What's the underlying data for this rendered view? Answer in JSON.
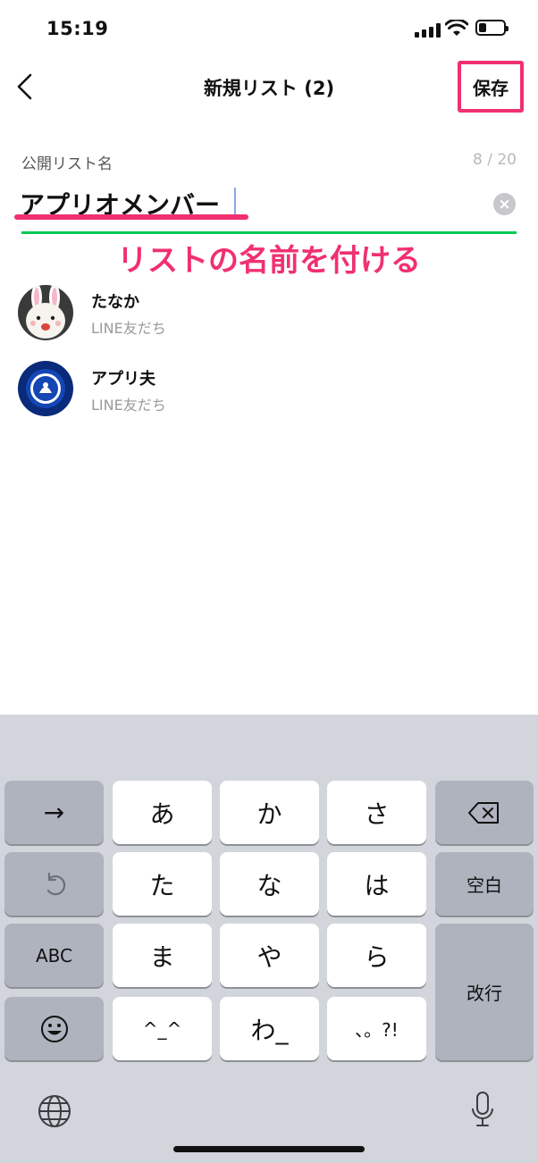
{
  "status": {
    "time": "15:19"
  },
  "nav": {
    "title": "新規リスト (2)",
    "save": "保存"
  },
  "form": {
    "label": "公開リスト名",
    "counter": "8 / 20",
    "value": "アプリオメンバー",
    "clear": "×"
  },
  "annotation": "リストの名前を付ける",
  "members": [
    {
      "name": "たなか",
      "sub": "LINE友だち"
    },
    {
      "name": "アプリ夫",
      "sub": "LINE友だち"
    }
  ],
  "keyboard": {
    "arrow": "→",
    "row1": [
      "あ",
      "か",
      "さ"
    ],
    "row2": [
      "た",
      "な",
      "は"
    ],
    "row3": [
      "ま",
      "や",
      "ら"
    ],
    "row4": [
      "^_^",
      "わ_",
      "、。?!"
    ],
    "space": "空白",
    "abc": "ABC",
    "enter": "改行"
  },
  "colors": {
    "accent": "#f0306f",
    "line_green": "#06c755"
  }
}
